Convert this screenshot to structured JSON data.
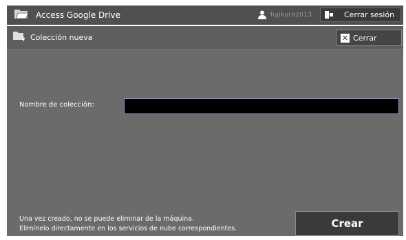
{
  "header": {
    "app_title": "Access Google Drive",
    "app_icon": "drive-folder-icon",
    "user_icon": "user-icon",
    "user_name": "fujikura2013",
    "logout_icon": "logout-icon",
    "logout_label": "Cerrar sesión"
  },
  "dialog": {
    "title_icon": "new-folder-icon",
    "title": "Colección nueva",
    "close_icon": "close-icon",
    "close_glyph": "✕",
    "close_label": "Cerrar",
    "field_label": "Nombre de colección:",
    "field_value": "",
    "notice_line1": "Una vez creado, no se puede eliminar de la máquina.",
    "notice_line2": "Elimínelo directamente en los servicios de nube correspondientes.",
    "create_label": "Crear"
  }
}
